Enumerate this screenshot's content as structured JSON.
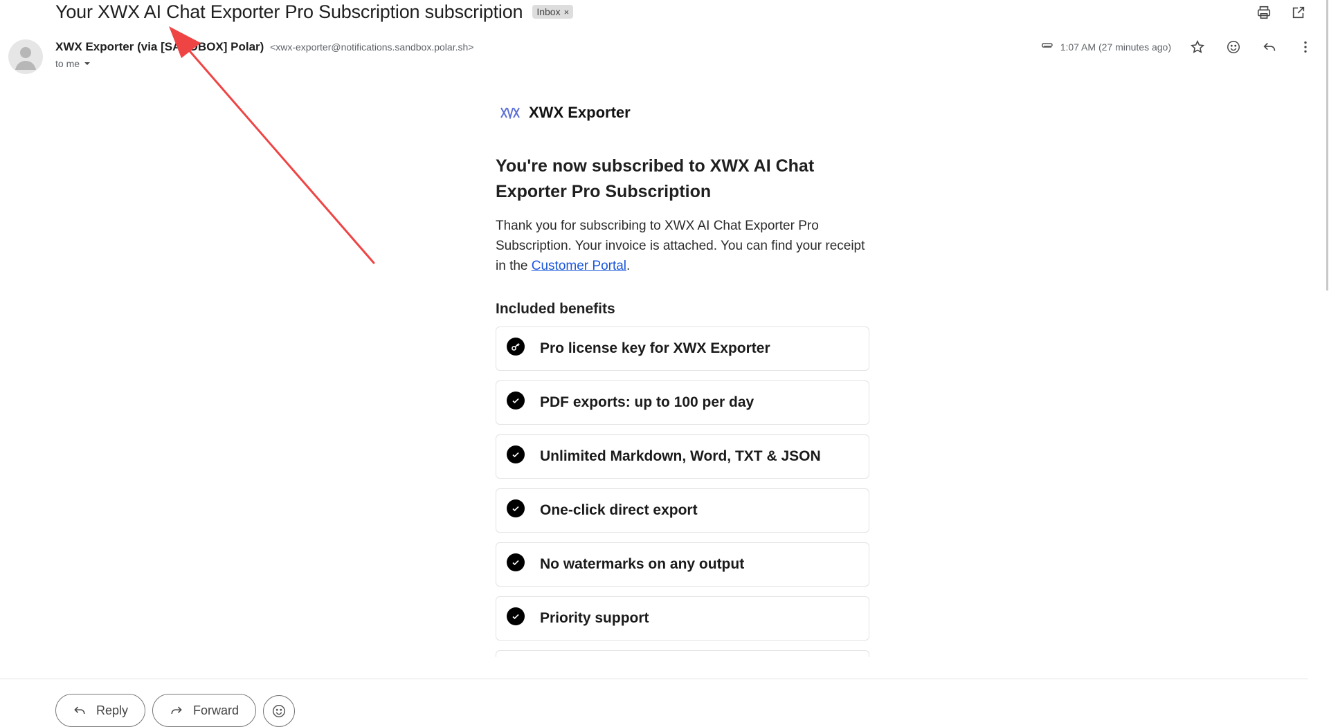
{
  "email": {
    "subject": "Your XWX AI Chat Exporter Pro Subscription subscription",
    "label": "Inbox",
    "sender_name": "XWX Exporter (via [SANDBOX] Polar)",
    "sender_email": "<xwx-exporter@notifications.sandbox.polar.sh>",
    "recipient": "to me",
    "time": "1:07 AM (27 minutes ago)"
  },
  "message": {
    "brand_name": "XWX Exporter",
    "heading": "You're now subscribed to XWX AI Chat Exporter Pro Subscription",
    "body_before_link": "Thank you for subscribing to XWX AI Chat Exporter Pro Subscription. Your invoice is attached. You can find your receipt in the ",
    "link_text": "Customer Portal",
    "body_after_link": ".",
    "benefits_title": "Included benefits",
    "benefits": [
      {
        "label": "Pro license key for XWX Exporter",
        "icon": "key-icon"
      },
      {
        "label": "PDF exports: up to 100 per day",
        "icon": "check-icon"
      },
      {
        "label": "Unlimited Markdown, Word, TXT & JSON",
        "icon": "check-icon"
      },
      {
        "label": "One-click direct export",
        "icon": "check-icon"
      },
      {
        "label": "No watermarks on any output",
        "icon": "check-icon"
      },
      {
        "label": "Priority support",
        "icon": "check-icon"
      }
    ]
  },
  "actions": {
    "reply": "Reply",
    "forward": "Forward"
  },
  "annotation": {
    "arrow_color": "#ef4444"
  }
}
